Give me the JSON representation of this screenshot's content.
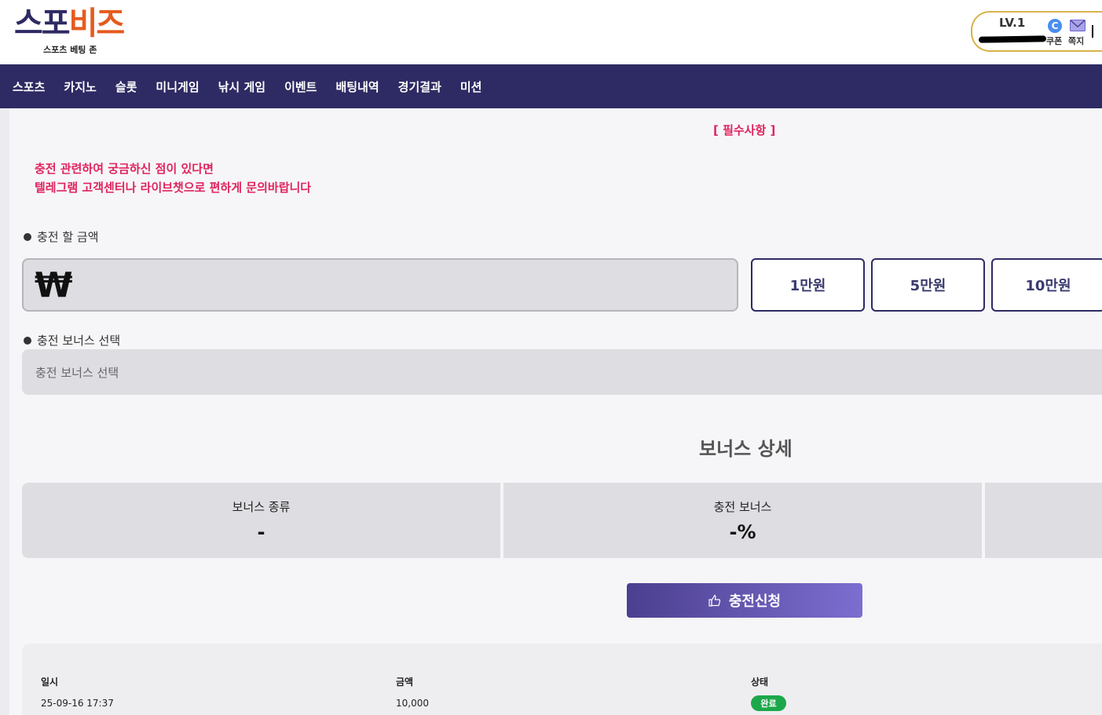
{
  "header": {
    "logo_main_1": "스포",
    "logo_main_2": "비즈",
    "logo_sub": "스포츠 베팅 존",
    "level": "LV.1",
    "coupon_label": "쿠폰",
    "message_label": "쪽지"
  },
  "nav": {
    "items": [
      "스포츠",
      "카지노",
      "슬롯",
      "미니게임",
      "낚시 게임",
      "이벤트",
      "배팅내역",
      "경기결과",
      "미션"
    ]
  },
  "notice": {
    "required": "[ 필수사항 ]",
    "line1": "충전 관련하여 궁금하신 점이 있다면",
    "line2": "텔레그램 고객센터나 라이브챗으로 편하게 문의바랍니다"
  },
  "amount": {
    "label": "충전 할 금액",
    "currency_symbol": "₩",
    "input_value": "",
    "quick_buttons": [
      "1만원",
      "5만원",
      "10만원"
    ]
  },
  "bonus_select": {
    "label": "충전 보너스 선택",
    "placeholder": "충전 보너스 선택"
  },
  "bonus_detail": {
    "title": "보너스 상세",
    "type_label": "보너스 종류",
    "type_value": "-",
    "rate_label": "충전 보너스",
    "rate_value": "-%"
  },
  "submit": {
    "label": "충전신청"
  },
  "history": {
    "columns": [
      "일시",
      "금액",
      "상태"
    ],
    "rows": [
      {
        "date": "25-09-16 17:37",
        "amount": "10,000",
        "status": "완료"
      }
    ]
  },
  "colors": {
    "brand_navy": "#2e2a63",
    "brand_orange": "#e65a1e",
    "notice_red": "#e0245e",
    "status_green": "#1ca84a"
  }
}
